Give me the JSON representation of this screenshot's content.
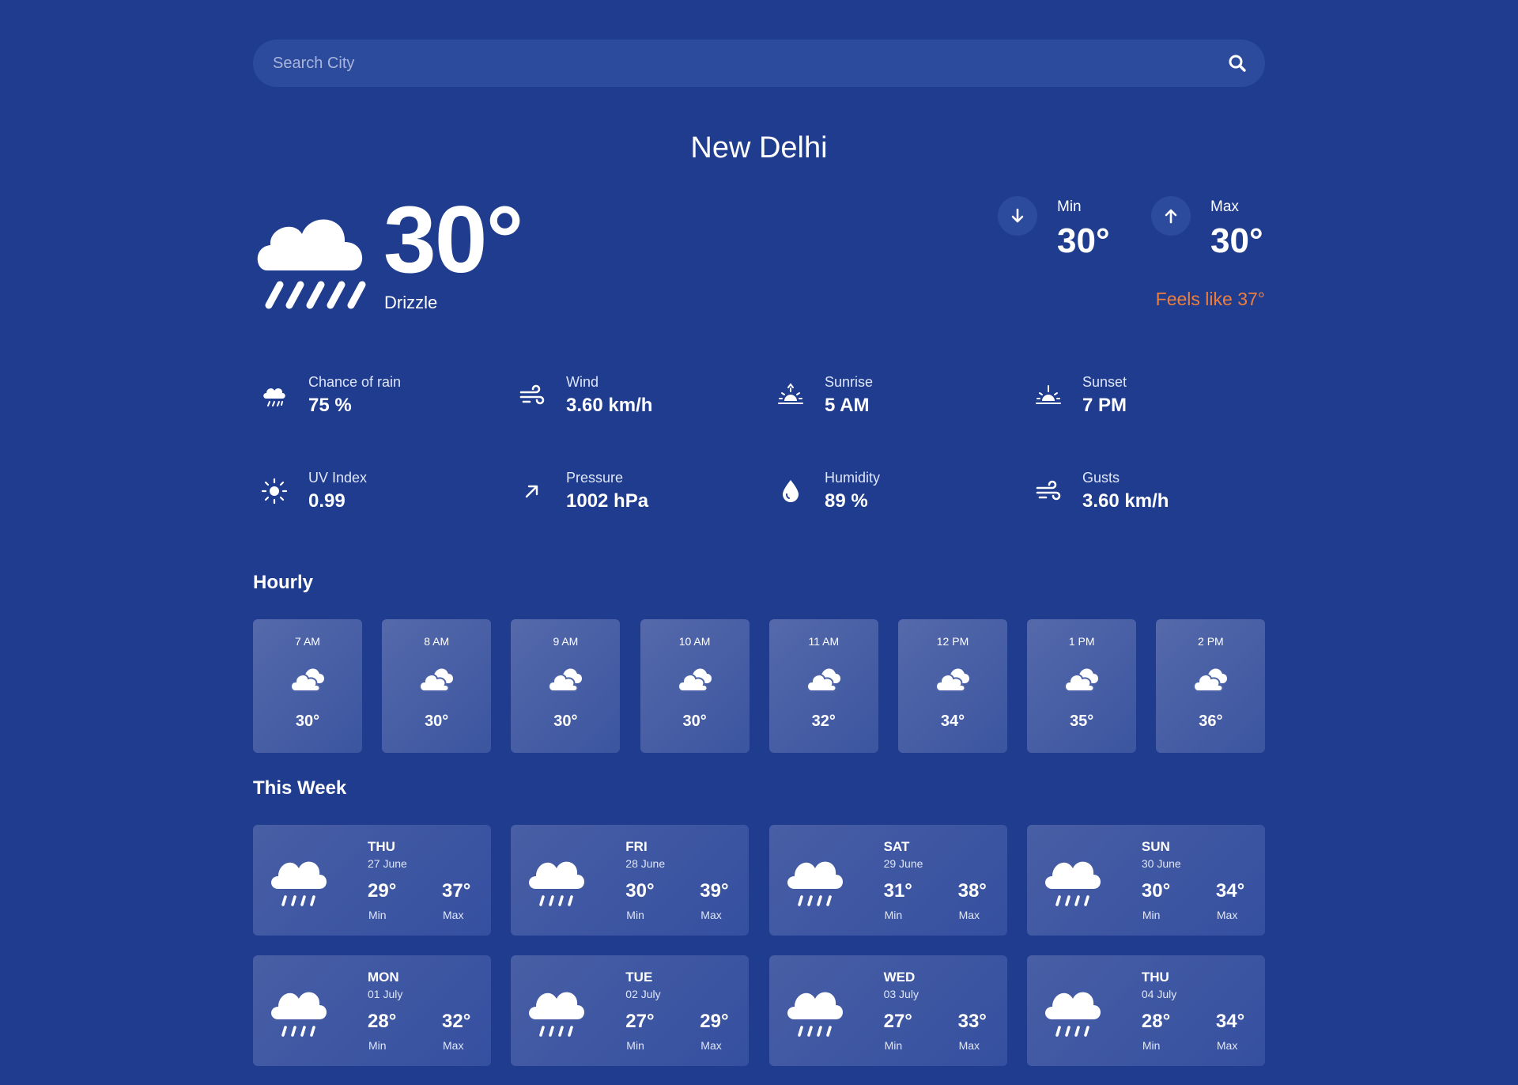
{
  "search": {
    "placeholder": "Search City"
  },
  "city": "New Delhi",
  "current": {
    "temp": "30°",
    "condition": "Drizzle",
    "min_label": "Min",
    "min": "30°",
    "max_label": "Max",
    "max": "30°",
    "feels_like": "Feels like 37°"
  },
  "stats": [
    {
      "label": "Chance of rain",
      "value": "75 %",
      "icon": "rain-cloud-icon"
    },
    {
      "label": "Wind",
      "value": "3.60 km/h",
      "icon": "wind-icon"
    },
    {
      "label": "Sunrise",
      "value": "5 AM",
      "icon": "sunrise-icon"
    },
    {
      "label": "Sunset",
      "value": "7 PM",
      "icon": "sunset-icon"
    },
    {
      "label": "UV Index",
      "value": "0.99",
      "icon": "sun-icon"
    },
    {
      "label": "Pressure",
      "value": "1002 hPa",
      "icon": "arrow-up-right-icon"
    },
    {
      "label": "Humidity",
      "value": "89 %",
      "icon": "droplet-icon"
    },
    {
      "label": "Gusts",
      "value": "3.60 km/h",
      "icon": "wind-icon"
    }
  ],
  "hourly_title": "Hourly",
  "hourly": [
    {
      "time": "7 AM",
      "temp": "30°"
    },
    {
      "time": "8 AM",
      "temp": "30°"
    },
    {
      "time": "9 AM",
      "temp": "30°"
    },
    {
      "time": "10 AM",
      "temp": "30°"
    },
    {
      "time": "11 AM",
      "temp": "32°"
    },
    {
      "time": "12 PM",
      "temp": "34°"
    },
    {
      "time": "1 PM",
      "temp": "35°"
    },
    {
      "time": "2 PM",
      "temp": "36°"
    }
  ],
  "week_title": "This Week",
  "week": [
    {
      "day": "THU",
      "date": "27 June",
      "min": "29°",
      "max": "37°",
      "min_label": "Min",
      "max_label": "Max"
    },
    {
      "day": "FRI",
      "date": "28 June",
      "min": "30°",
      "max": "39°",
      "min_label": "Min",
      "max_label": "Max"
    },
    {
      "day": "SAT",
      "date": "29 June",
      "min": "31°",
      "max": "38°",
      "min_label": "Min",
      "max_label": "Max"
    },
    {
      "day": "SUN",
      "date": "30 June",
      "min": "30°",
      "max": "34°",
      "min_label": "Min",
      "max_label": "Max"
    },
    {
      "day": "MON",
      "date": "01 July",
      "min": "28°",
      "max": "32°",
      "min_label": "Min",
      "max_label": "Max"
    },
    {
      "day": "TUE",
      "date": "02 July",
      "min": "27°",
      "max": "29°",
      "min_label": "Min",
      "max_label": "Max"
    },
    {
      "day": "WED",
      "date": "03 July",
      "min": "27°",
      "max": "33°",
      "min_label": "Min",
      "max_label": "Max"
    },
    {
      "day": "THU",
      "date": "04 July",
      "min": "28°",
      "max": "34°",
      "min_label": "Min",
      "max_label": "Max"
    }
  ],
  "colors": {
    "background": "#1f3c8f",
    "accent": "#ee7f3b",
    "card": "#4a60a6"
  }
}
